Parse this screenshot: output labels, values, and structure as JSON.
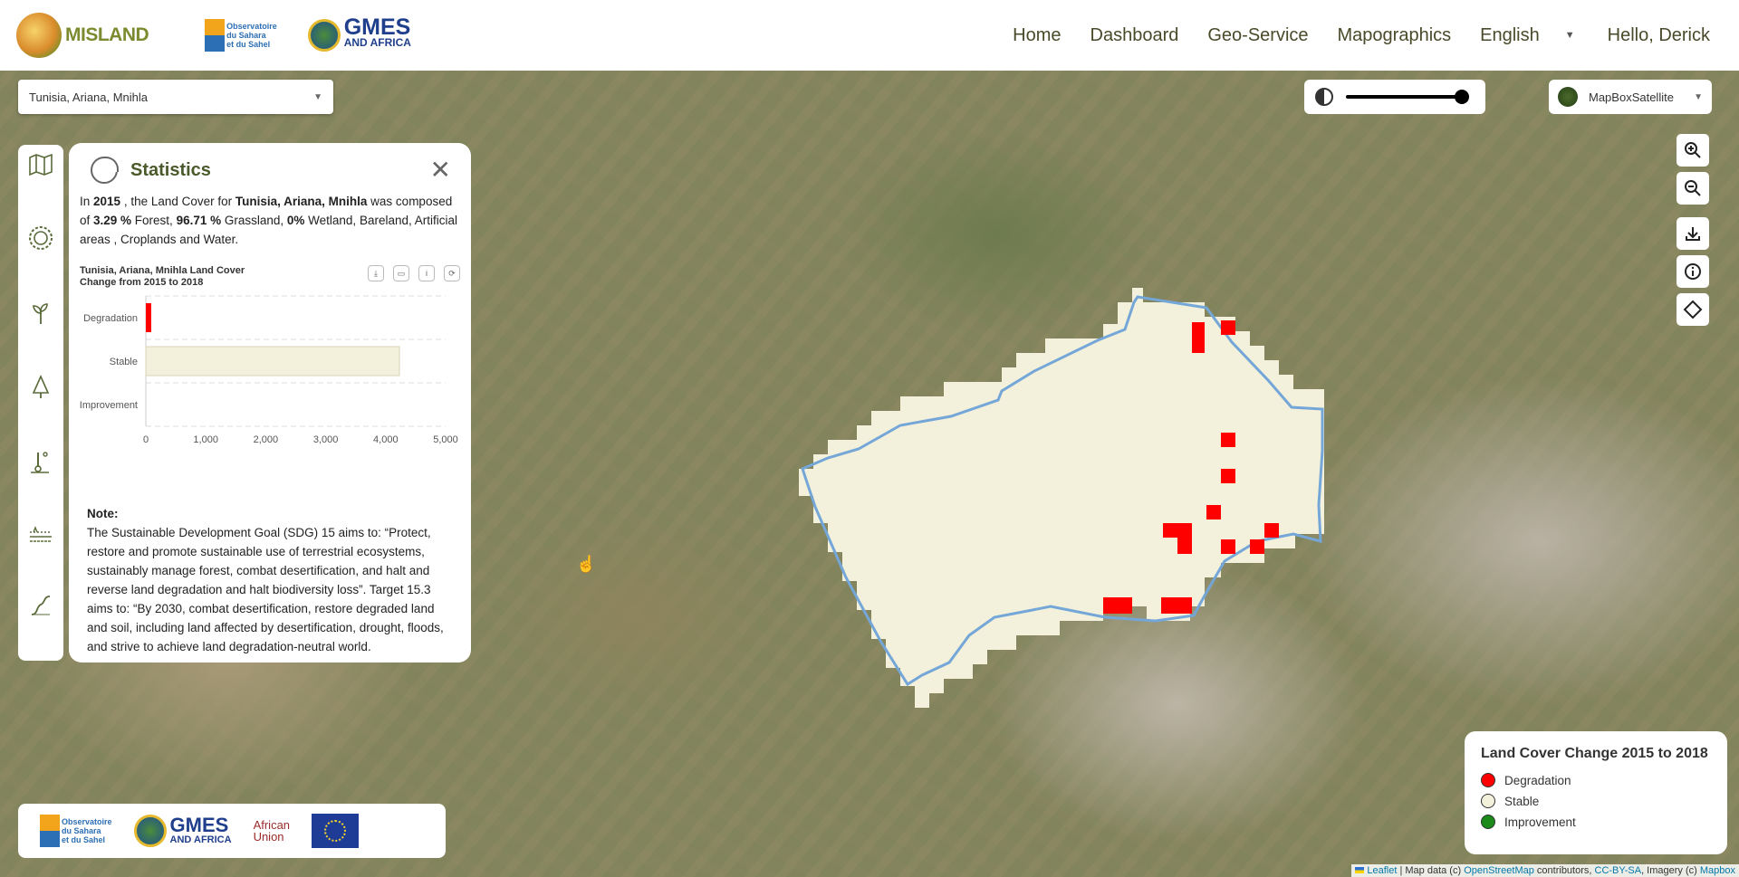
{
  "header": {
    "logo_text": "MISLAND",
    "oss_text_1": "Observatoire",
    "oss_text_2": "du Sahara",
    "oss_text_3": "et du Sahel",
    "gmes_big": "GMES",
    "gmes_small": "AND AFRICA",
    "nav": [
      "Home",
      "Dashboard",
      "Geo-Service",
      "Mapographics"
    ],
    "language": "English",
    "greeting": "Hello, Derick"
  },
  "map": {
    "location_select": "Tunisia, Ariana, Mnihla",
    "basemap": "MapBoxSatellite",
    "opacity_level": 1.0,
    "region_fill_color": "#f3f0dc",
    "region_outline_color": "#74a7d8",
    "degradation_color": "#ff0000"
  },
  "stats": {
    "title": "Statistics",
    "summary_parts": {
      "p1": "In ",
      "year": "2015",
      "p2": " , the Land Cover for ",
      "place": "Tunisia, Ariana, Mnihla",
      "p3": " was composed of ",
      "forest_pct": "3.29 %",
      "p4": " Forest, ",
      "grass_pct": "96.71 %",
      "p5": " Grassland, ",
      "zero_pct": "0%",
      "p6": " Wetland, Bareland, Artificial areas , Croplands and Water."
    },
    "chart_title": "Tunisia, Ariana, Mnihla Land Cover Change from 2015 to 2018",
    "note_label": "Note:",
    "note_text": "The Sustainable Development Goal (SDG) 15 aims to: “Protect, restore and promote sustainable use of terrestrial ecosystems, sustainably manage forest, combat desertification, and halt and reverse land degradation and halt biodiversity loss”. Target 15.3 aims to: “By 2030, combat desertification, restore degraded land and soil, including land affected by desertification, drought, floods, and strive to achieve land degradation-neutral world."
  },
  "chart_data": {
    "type": "bar",
    "orientation": "horizontal",
    "title": "Tunisia, Ariana, Mnihla Land Cover Change from 2015 to 2018",
    "categories": [
      "Degradation",
      "Stable",
      "Improvement"
    ],
    "values": [
      90,
      4230,
      0
    ],
    "colors": [
      "#ff0000",
      "#f3f0dc",
      "#2e7d32"
    ],
    "xlim": [
      0,
      5000
    ],
    "xticks": [
      "0",
      "1,000",
      "2,000",
      "3,000",
      "4,000",
      "5,000"
    ],
    "grid": true
  },
  "legend": {
    "title": "Land Cover Change 2015 to 2018",
    "items": [
      {
        "label": "Degradation",
        "color": "#ff0000"
      },
      {
        "label": "Stable",
        "color": "#f3f0dc"
      },
      {
        "label": "Improvement",
        "color": "#1b8a1b"
      }
    ]
  },
  "partners": {
    "au_1": "African",
    "au_2": "Union"
  },
  "attribution": {
    "leaflet": "Leaflet",
    "p1": " | Map data (c) ",
    "osm": "OpenStreetMap",
    "p2": " contributors, ",
    "cc": "CC-BY-SA",
    "p3": ", Imagery (c) ",
    "mapbox": "Mapbox"
  }
}
